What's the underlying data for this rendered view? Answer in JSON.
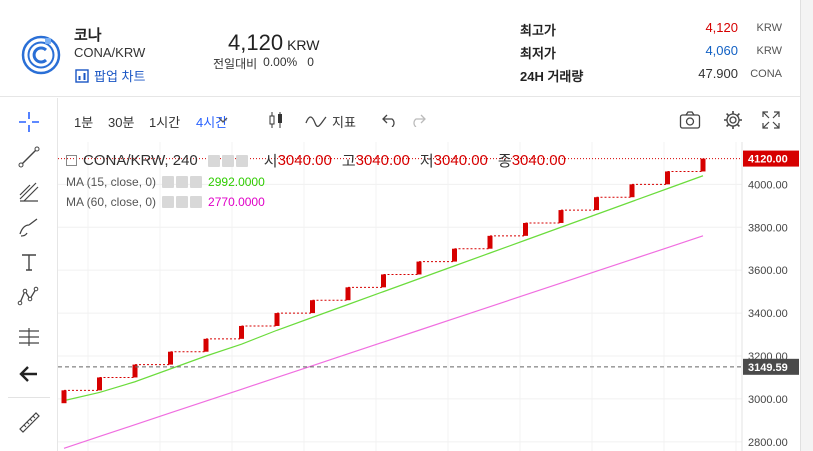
{
  "coin": {
    "name": "코나",
    "pair": "CONA/KRW",
    "popup_label": "팝업 차트",
    "price": "4,120",
    "price_unit": "KRW",
    "change_label": "전일대비",
    "change_pct": "0.00%",
    "change_abs": "0"
  },
  "stats": {
    "high_label": "최고가",
    "high_value": "4,120",
    "high_unit": "KRW",
    "low_label": "최저가",
    "low_value": "4,060",
    "low_unit": "KRW",
    "volume_label": "24H 거래량",
    "volume_value": "47.900",
    "volume_unit": "CONA"
  },
  "toolbar": {
    "interval_1m": "1분",
    "interval_30m": "30분",
    "interval_1h": "1시간",
    "interval_4h": "4시간",
    "indicator_label": "지표",
    "icons": [
      "crosshair-icon",
      "trend-line-icon",
      "fib-icon",
      "brush-icon",
      "text-icon",
      "pattern-icon",
      "measure-icon",
      "back-arrow-icon",
      "ruler-icon"
    ]
  },
  "legend": {
    "symbol": "CONA/KRW, 240",
    "open_label": "시",
    "open": "3040.00",
    "high_label": "고",
    "high": "3040.00",
    "low_label": "저",
    "low": "3040.00",
    "close_label": "종",
    "close": "3040.00",
    "ma15_label": "MA (15, close, 0)",
    "ma15_value": "2992.0000",
    "ma60_label": "MA (60, close, 0)",
    "ma60_value": "2770.0000"
  },
  "price_axis": {
    "ticks": [
      "4000.00",
      "3800.00",
      "3600.00",
      "3400.00",
      "3200.00",
      "3000.00",
      "2800.00"
    ],
    "last_price_tag": "4120.00",
    "crosshair_tag": "3149.59"
  },
  "colors": {
    "up": "#d60000",
    "ma15": "#6bdc3c",
    "ma60": "#f06ee0",
    "active": "#2962ff"
  },
  "chart_data": {
    "type": "candlestick",
    "series": [
      {
        "name": "CONA/KRW, 240",
        "values": [
          3040,
          3100,
          3160,
          3220,
          3280,
          3340,
          3400,
          3460,
          3520,
          3580,
          3640,
          3700,
          3760,
          3820,
          3880,
          3940,
          4000,
          4060,
          4120
        ]
      },
      {
        "name": "MA (15, close, 0)",
        "values": [
          2992,
          3030,
          3080,
          3140,
          3200,
          3255,
          3320,
          3380,
          3440,
          3500,
          3560,
          3620,
          3680,
          3740,
          3800,
          3860,
          3920,
          3980,
          4040
        ]
      },
      {
        "name": "MA (60, close, 0)",
        "values": [
          2770,
          2825,
          2880,
          2935,
          2990,
          3045,
          3100,
          3155,
          3210,
          3265,
          3320,
          3375,
          3430,
          3485,
          3540,
          3595,
          3650,
          3705,
          3760
        ]
      }
    ],
    "ylim": [
      2720,
      4160
    ],
    "ylabel": "",
    "xlabel": ""
  }
}
